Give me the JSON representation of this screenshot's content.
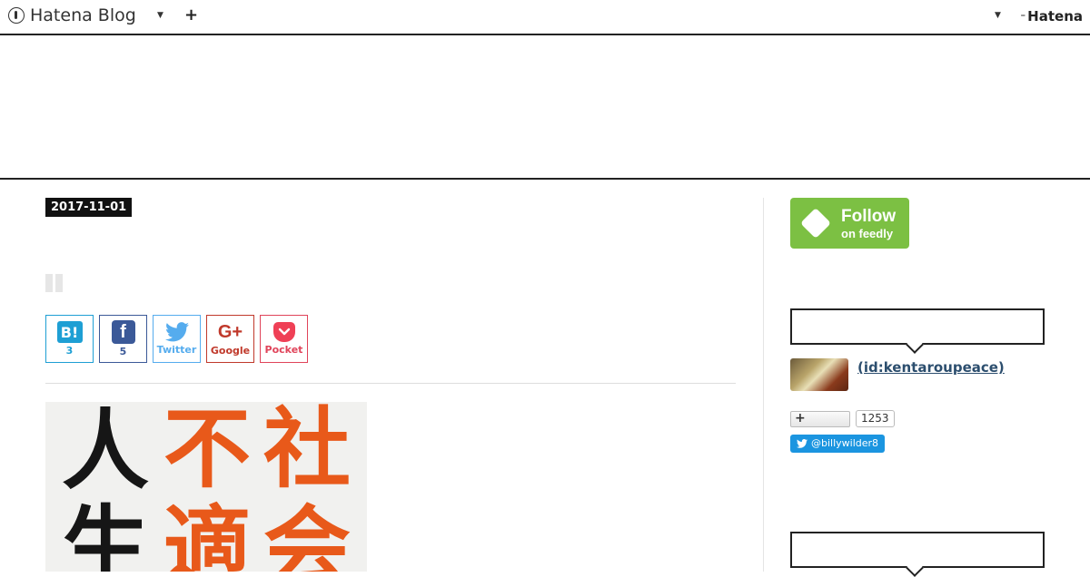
{
  "header": {
    "brand": "Hatena Blog",
    "logo_text": "Hatena",
    "plus_label": "+"
  },
  "entry": {
    "date": "2017-11-01"
  },
  "share": {
    "hatena": {
      "icon": "B!",
      "count": "3"
    },
    "facebook": {
      "icon": "f",
      "count": "5"
    },
    "twitter": {
      "label": "Twitter"
    },
    "google": {
      "icon": "G+",
      "label": "Google"
    },
    "pocket": {
      "label": "Pocket"
    }
  },
  "cover": {
    "column1": [
      "人",
      "生"
    ],
    "column2": [
      "不",
      "適"
    ],
    "column3": [
      "社",
      "会"
    ]
  },
  "sidebar": {
    "feedly": {
      "main": "Follow",
      "sub": "on feedly"
    },
    "profile": {
      "id": " (id:kentaroupeace)"
    },
    "follow": {
      "plus": "+",
      "count": "1253"
    },
    "twitter": {
      "handle": "@billywilder8"
    }
  },
  "colors": {
    "accent_orange": "#e8591a",
    "feedly_green": "#7cc043",
    "twitter_blue": "#1b95e0"
  }
}
